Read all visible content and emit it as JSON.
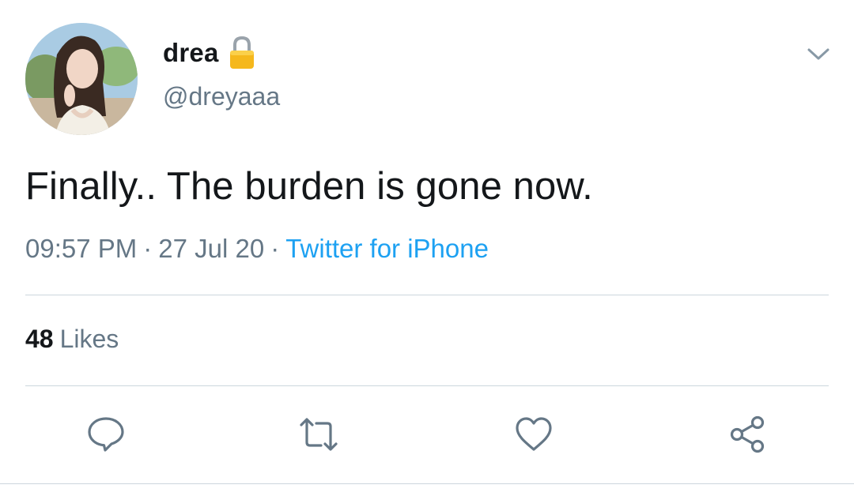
{
  "tweet": {
    "display_name": "drea",
    "handle": "@dreyaaa",
    "text": "Finally.. The burden is gone now.",
    "time": "09:57 PM",
    "date": "27 Jul 20",
    "source": "Twitter for iPhone",
    "separator": "·",
    "likes_count": "48",
    "likes_label": "Likes"
  },
  "icons": {
    "lock": "lock-icon",
    "caret": "chevron-down-icon",
    "reply": "reply-icon",
    "retweet": "retweet-icon",
    "like": "heart-icon",
    "share": "share-icon"
  },
  "colors": {
    "text": "#14171a",
    "secondary": "#657786",
    "link": "#1da1f2",
    "divider": "#ccd6dd",
    "lock": "#f5b81c"
  }
}
